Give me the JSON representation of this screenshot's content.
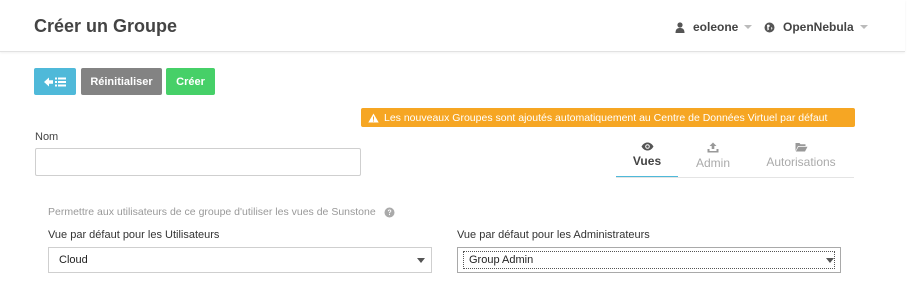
{
  "header": {
    "title": "Créer un Groupe",
    "user": "eoleone",
    "zone": "OpenNebula"
  },
  "toolbar": {
    "reset_label": "Réinitialiser",
    "create_label": "Créer"
  },
  "warning": {
    "text": "Les nouveaux Groupes sont ajoutés automatiquement au Centre de Données Virtuel par défaut"
  },
  "form": {
    "name_label": "Nom",
    "name_value": ""
  },
  "tabs": [
    {
      "label": "Vues",
      "icon": "eye-icon",
      "active": true
    },
    {
      "label": "Admin",
      "icon": "upload-icon",
      "active": false
    },
    {
      "label": "Autorisations",
      "icon": "folder-open-icon",
      "active": false
    }
  ],
  "views": {
    "description": "Permettre aux utilisateurs de ce groupe d'utiliser les vues de Sunstone",
    "user_view_label": "Vue par défaut pour les Utilisateurs",
    "user_view_value": "Cloud",
    "admin_view_label": "Vue par défaut pour les Administrateurs",
    "admin_view_value": "Group Admin"
  },
  "colors": {
    "info": "#4fb9d9",
    "secondary": "#838383",
    "success": "#46d068",
    "warning": "#f6a623"
  }
}
